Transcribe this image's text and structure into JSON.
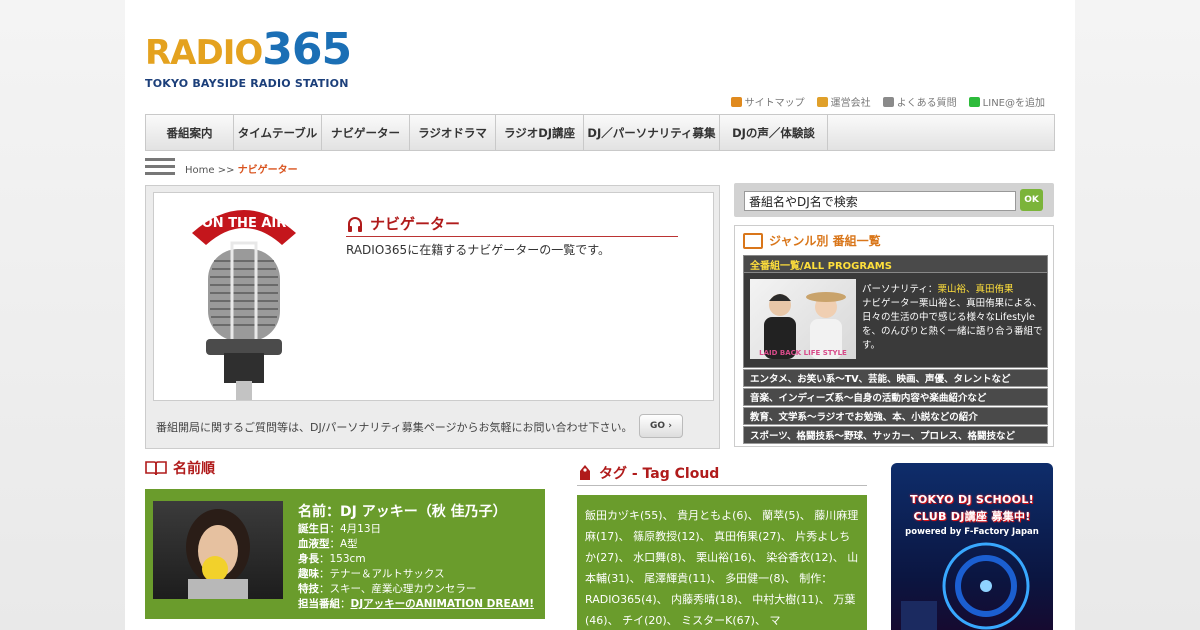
{
  "logo": {
    "word_a": "RADIO",
    "word_b": "365",
    "tagline": "TOKYO BAYSIDE RADIO STATION"
  },
  "util_links": [
    {
      "label": "サイトマップ",
      "color": "#e08a1e"
    },
    {
      "label": "運営会社",
      "color": "#e0a02a"
    },
    {
      "label": "よくある質問",
      "color": "#8a8a8a"
    },
    {
      "label": "LINE@を追加",
      "color": "#2dbb3b"
    }
  ],
  "nav": [
    {
      "label": "番組案内"
    },
    {
      "label": "タイムテーブル"
    },
    {
      "label": "ナビゲーター"
    },
    {
      "label": "ラジオドラマ"
    },
    {
      "label": "ラジオDJ講座"
    },
    {
      "label": "DJ／パーソナリティ募集"
    },
    {
      "label": "DJの声／体験談"
    }
  ],
  "breadcrumb": {
    "home": "Home",
    "sep": ">>",
    "current": "ナビゲーター"
  },
  "hero": {
    "sign_text": "ON THE AIR",
    "title": "ナビゲーター",
    "desc": "RADIO365に在籍するナビゲーターの一覧です。",
    "footer": "番組開局に関するご質問等は、DJ/パーソナリティ募集ページからお気軽にお問い合わせ下さい。",
    "go": "GO"
  },
  "search": {
    "value": "番組名やDJ名で検索",
    "ok": "OK"
  },
  "genre": {
    "title": "ジャンル別 番組一覧",
    "all": "全番組一覧/ALL PROGRAMS",
    "feature": {
      "personality_label": "パーソナリティ：",
      "personality_names": "栗山裕、真田侑果",
      "desc": "ナビゲーター栗山裕と、真田侑果による、日々の生活の中で感じる様々なLifestyleを、のんびりと熱く一緒に語り合う番組です。",
      "img_caption": "LAID BACK LIFE STYLE"
    },
    "rows": [
      "エンタメ、お笑い系～TV、芸能、映画、声優、タレントなど",
      "音楽、インディーズ系～自身の活動内容や楽曲紹介など",
      "教育、文学系～ラジオでお勉強、本、小説などの紹介",
      "スポーツ、格闘技系～野球、サッカー、プロレス、格闘技など"
    ]
  },
  "name_order": {
    "title": "名前順"
  },
  "profile": {
    "name": "名前：DJ アッキー（秋 佳乃子）",
    "rows": [
      {
        "k": "誕生日",
        "v": "4月13日"
      },
      {
        "k": "血液型",
        "v": "A型"
      },
      {
        "k": "身長",
        "v": "153cm"
      },
      {
        "k": "趣味",
        "v": "テナー＆アルトサックス"
      },
      {
        "k": "特技",
        "v": "スキー、産業心理カウンセラー"
      }
    ],
    "program_label": "担当番組",
    "program_link": "DJアッキーのANIMATION DREAM!"
  },
  "tag_cloud": {
    "title": "タグ - Tag Cloud",
    "text": "飯田カヅキ(55)、 貴月ともよ(6)、 蘭萃(5)、 藤川麻理麻(17)、 篠原教授(12)、 真田侑果(27)、 片秀よしちか(27)、 水口舞(8)、 栗山裕(16)、 染谷香衣(12)、 山本輔(31)、 尾澤輝貴(11)、 多田健一(8)、 制作：RADIO365(4)、 内藤秀晴(18)、 中村大樹(11)、 万葉(46)、 チイ(20)、 ミスターK(67)、 マ"
  },
  "banner": {
    "line1": "TOKYO DJ SCHOOL!",
    "line2": "CLUB DJ講座 募集中!",
    "line3": "powered by F-Factory Japan"
  }
}
